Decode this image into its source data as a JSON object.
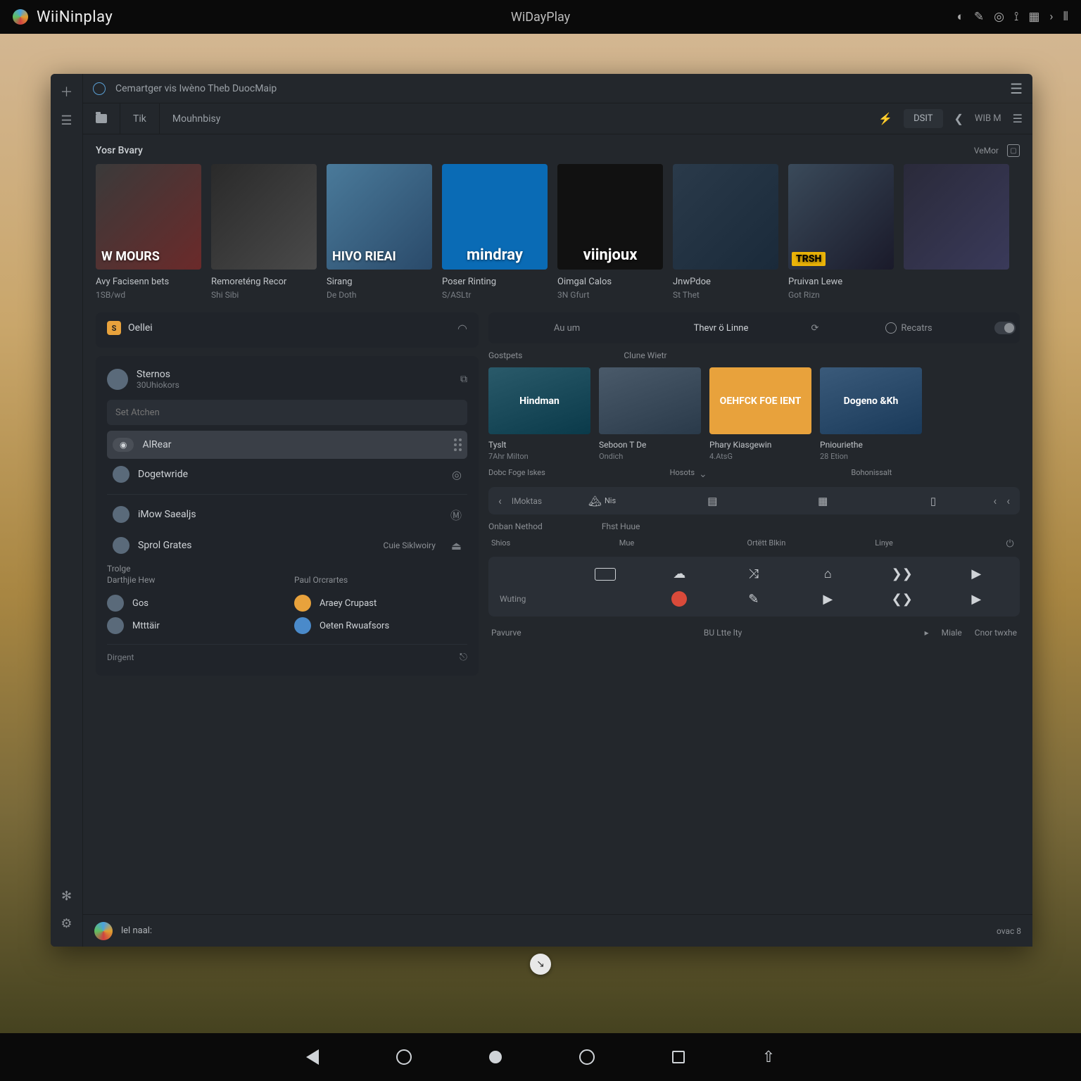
{
  "system": {
    "app_name": "WiiNinplay",
    "center_title": "WiDayPlay",
    "tray_time_row": "⎯ › ⫶"
  },
  "titlebar": {
    "breadcrumb": "Cemartger vis Iwèno Theb DuocMaip"
  },
  "toolbar": {
    "tab_tk": "Tik",
    "tab_main": "Mouhnbisy",
    "right_btn": "DSIT",
    "right_label": "WIB M"
  },
  "library": {
    "heading": "Yosr Bvary",
    "more": "VeMor",
    "albums": [
      {
        "title": "Avy Facisenn bets",
        "sub": "1SB/wd",
        "cover_label": "W  MOURS"
      },
      {
        "title": "Remoreténg Recor",
        "sub": "Shi Sibi",
        "cover_label": ""
      },
      {
        "title": "Sirang",
        "sub": "De Doth",
        "cover_label": "HIVO RIEAI"
      },
      {
        "title": "Poser Rinting",
        "sub": "S/ASLtr",
        "cover_label": "mindray"
      },
      {
        "title": "Oimgal Calos",
        "sub": "3N Gfurt",
        "cover_label": "viinjoux"
      },
      {
        "title": "JnwPdoe",
        "sub": "St Thet",
        "cover_label": ""
      },
      {
        "title": "Pruivan Lewe",
        "sub": "Got Rizn",
        "cover_label": "TRSH"
      },
      {
        "title": "",
        "sub": "",
        "cover_label": ""
      }
    ]
  },
  "left": {
    "panel1": {
      "badge": "S",
      "label": "Oellei"
    },
    "user": {
      "name": "Sternos",
      "sub": "30Uhiokors"
    },
    "search_ph": "Set Atchen",
    "items": [
      {
        "label": "AlRear",
        "active": true
      },
      {
        "label": "Dogetwride"
      },
      {
        "label": "iMow Saealjs"
      },
      {
        "label": "Sprol Grates",
        "right": "Cuie Siklwoiry"
      }
    ],
    "trolge": "Trolge",
    "cols": {
      "c1h": "Darthjie Hew",
      "c2h": "Paul Orcrartes",
      "rows": [
        [
          "Gos",
          "Araey Crupast"
        ],
        [
          "Mtttäir",
          "Oeten Rwuafsors"
        ]
      ]
    },
    "footer": "Dirgent"
  },
  "right": {
    "tabs": [
      "Au um",
      "Thevr ö Linne",
      "Recatrs"
    ],
    "sub_headers": [
      "Gostpets",
      "Clune Wietr"
    ],
    "minis": [
      {
        "title": "Tyslt",
        "sub": "7Ahr Milton",
        "label": "Hindman"
      },
      {
        "title": "Seboon T De",
        "sub": "Ondich",
        "label": ""
      },
      {
        "title": "Phary Kiasgewin",
        "sub": "4.AtsG",
        "label": "OEHFCK FOE IENT"
      },
      {
        "title": "Pniouriethe",
        "sub": "28 Etion",
        "label": "Dogeno &Kh"
      }
    ],
    "kv": [
      {
        "k": "Dobc Foge Iskes",
        "v": ""
      },
      {
        "k": "Hosots",
        "v": ""
      },
      {
        "k": "Bohonissalt",
        "v": ""
      }
    ],
    "toolstrip": {
      "left": "IMoktas",
      "b1": "Nis"
    },
    "below_strip": [
      "Onban Nethod",
      "Fhst Huue"
    ],
    "grid_hdr": [
      "Shios",
      "Mue",
      "Ortëtt Blkin",
      "Linye"
    ],
    "grid_rows": [
      {
        "lead": ""
      },
      {
        "lead": "Wuting"
      }
    ],
    "footer": {
      "a": "Pavurve",
      "b": "BU Ltte lty",
      "c": "Miale",
      "d": "Cnor twxhe"
    }
  },
  "nowplaying": {
    "title": "lel naal:",
    "right": "ovac 8"
  }
}
